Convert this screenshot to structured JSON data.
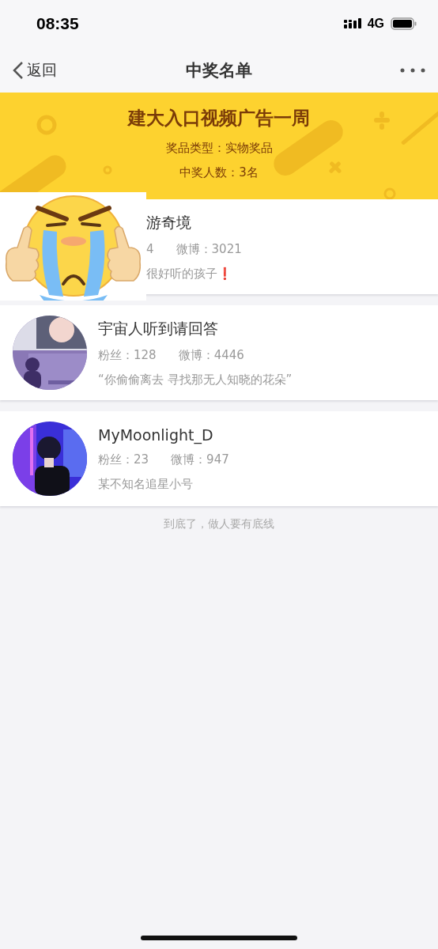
{
  "status_bar": {
    "time": "08:35",
    "network": "4G"
  },
  "nav": {
    "back": "返回",
    "title": "中奖名单"
  },
  "banner": {
    "title": "建大入口视频广告一周",
    "prize_type": "奖品类型：实物奖品",
    "winner_count": "中奖人数：3名"
  },
  "winners": [
    {
      "kind": "covered",
      "name": "游奇境",
      "fans": "4",
      "weibo": "微博：3021",
      "bio": "很好听的孩子❗"
    },
    {
      "kind": "full",
      "name": "宇宙人听到请回答",
      "fans": "粉丝：128",
      "weibo": "微博：4446",
      "bio": "“你偷偷离去 寻找那无人知晓的花朵”"
    },
    {
      "kind": "full",
      "name": "MyMoonlight_D",
      "fans": "粉丝：23",
      "weibo": "微博：947",
      "bio": "某不知名追星小号"
    }
  ],
  "footer": "到底了，做人要有底线"
}
